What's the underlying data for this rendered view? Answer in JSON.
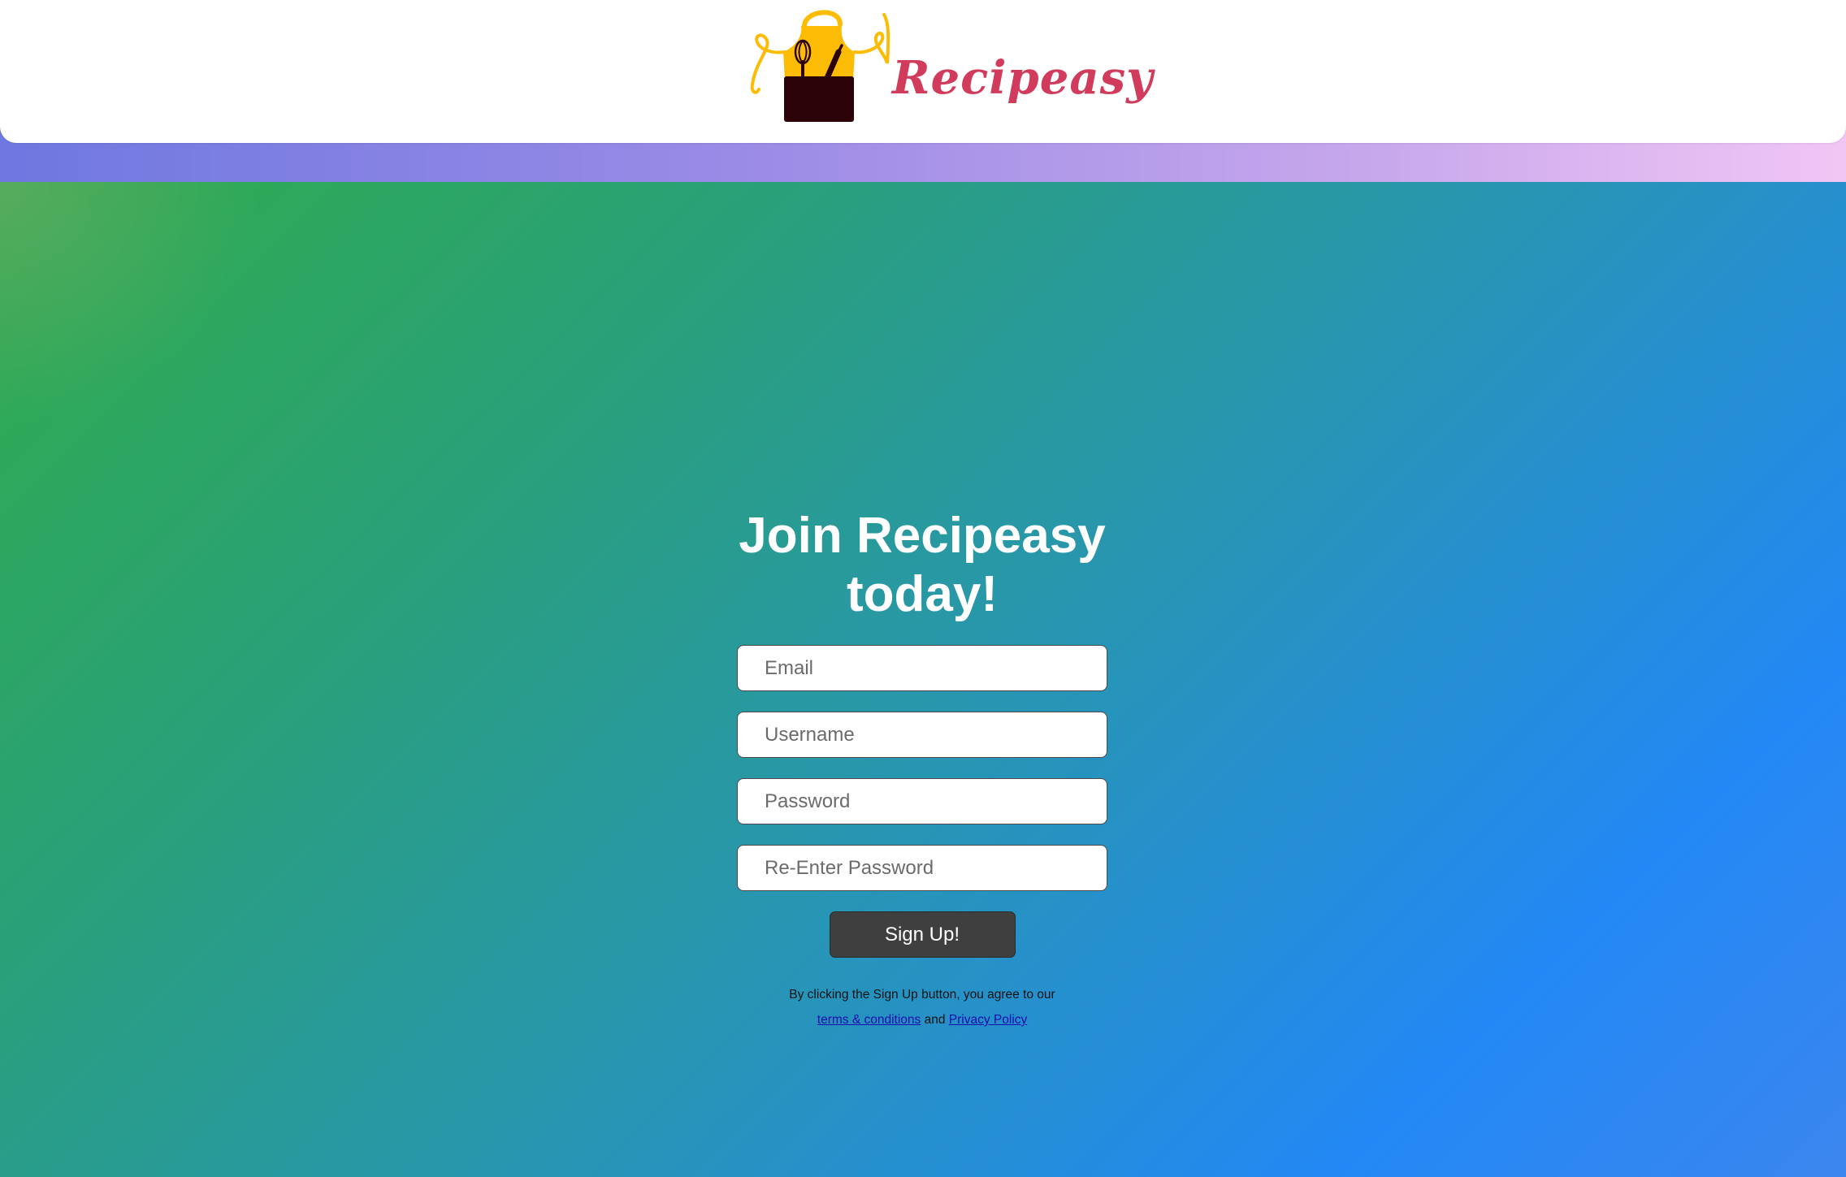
{
  "header": {
    "brand_name": "Recipeasy",
    "logo_icon": "apron-with-whisk-and-rolling-pin-icon"
  },
  "signup": {
    "title": "Join Recipeasy today!",
    "email_placeholder": "Email",
    "username_placeholder": "Username",
    "password_placeholder": "Password",
    "reenter_password_placeholder": "Re-Enter Password",
    "button_label": "Sign Up!",
    "legal_prefix": "By clicking the Sign Up button, you agree to our",
    "terms_link": "terms & conditions",
    "legal_and": "and",
    "privacy_link": "Privacy Policy"
  },
  "colors": {
    "brand_text": "#d13b5c",
    "apron_top": "#fcbc05",
    "apron_pocket": "#2a0208",
    "button_bg": "#3f3f3f",
    "gradient_start": "#2fad4a",
    "gradient_end": "#2388f5",
    "strip_start": "#6e78e0",
    "strip_end": "#f1c6f5"
  }
}
